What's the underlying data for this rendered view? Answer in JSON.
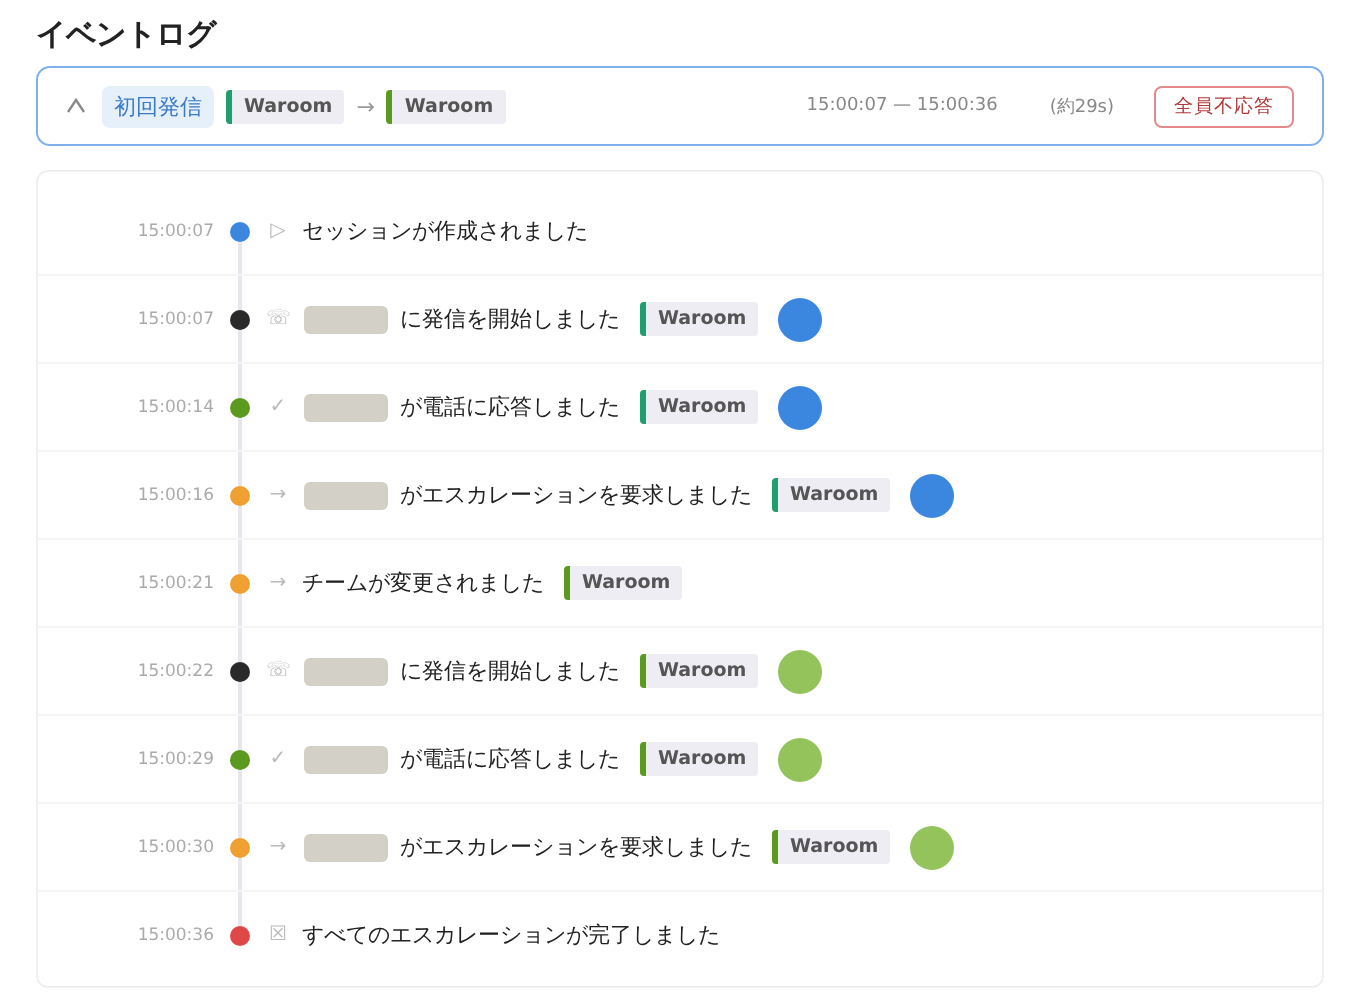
{
  "title": "イベントログ",
  "summary": {
    "expanded": true,
    "label": "初回発信",
    "from": {
      "name": "Waroom",
      "color": "#1f9e6e"
    },
    "arrow": "→",
    "to": {
      "name": "Waroom",
      "color": "#5b9a1e"
    },
    "range": "15:00:07 — 15:00:36",
    "duration": "(約29s)",
    "status": "全員不応答"
  },
  "events": [
    {
      "time": "15:00:07",
      "color": "#3b87e0",
      "icon": "▷",
      "redacted_name": false,
      "text": "セッションが作成されました"
    },
    {
      "time": "15:00:07",
      "color": "#2a2a2a",
      "icon": "☏",
      "redacted_name": true,
      "text": "に発信を開始しました",
      "tag": {
        "name": "Waroom",
        "color": "#1f9e6e"
      },
      "avatar": {
        "color": "#3b87e0"
      }
    },
    {
      "time": "15:00:14",
      "color": "#5b9a1e",
      "icon": "✓",
      "redacted_name": true,
      "text": "が電話に応答しました",
      "tag": {
        "name": "Waroom",
        "color": "#1f9e6e"
      },
      "avatar": {
        "color": "#3b87e0"
      }
    },
    {
      "time": "15:00:16",
      "color": "#f0a030",
      "icon": "→",
      "redacted_name": true,
      "text": "がエスカレーションを要求しました",
      "tag": {
        "name": "Waroom",
        "color": "#1f9e6e"
      },
      "avatar": {
        "color": "#3b87e0"
      }
    },
    {
      "time": "15:00:21",
      "color": "#f0a030",
      "icon": "→",
      "redacted_name": false,
      "text": "チームが変更されました",
      "tag": {
        "name": "Waroom",
        "color": "#5b9a1e"
      }
    },
    {
      "time": "15:00:22",
      "color": "#2a2a2a",
      "icon": "☏",
      "redacted_name": true,
      "text": "に発信を開始しました",
      "tag": {
        "name": "Waroom",
        "color": "#5b9a1e"
      },
      "avatar": {
        "color": "#93c35a"
      }
    },
    {
      "time": "15:00:29",
      "color": "#5b9a1e",
      "icon": "✓",
      "redacted_name": true,
      "text": "が電話に応答しました",
      "tag": {
        "name": "Waroom",
        "color": "#5b9a1e"
      },
      "avatar": {
        "color": "#93c35a"
      }
    },
    {
      "time": "15:00:30",
      "color": "#f0a030",
      "icon": "→",
      "redacted_name": true,
      "text": "がエスカレーションを要求しました",
      "tag": {
        "name": "Waroom",
        "color": "#5b9a1e"
      },
      "avatar": {
        "color": "#93c35a"
      }
    },
    {
      "time": "15:00:36",
      "color": "#e04848",
      "icon": "☒",
      "redacted_name": false,
      "text": "すべてのエスカレーションが完了しました"
    }
  ]
}
